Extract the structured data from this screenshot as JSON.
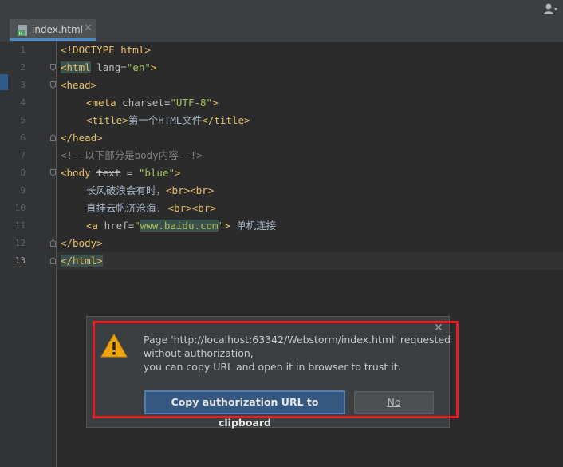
{
  "editor": {
    "tab": {
      "label": "index.html",
      "close": "✕"
    },
    "line_numbers": [
      "1",
      "2",
      "3",
      "4",
      "5",
      "6",
      "7",
      "8",
      "9",
      "10",
      "11",
      "12",
      "13"
    ],
    "lines": {
      "l1": {
        "tag": "<!DOCTYPE html>"
      },
      "l2": {
        "open": "<html",
        "attr": " lang=",
        "val": "\"en\"",
        "close": ">"
      },
      "l3": {
        "tag": "<head>"
      },
      "l4": {
        "open": "<meta",
        "attr": " charset=",
        "val": "\"UTF-8\"",
        "close": ">"
      },
      "l5": {
        "open": "<title>",
        "text": "第一个HTML文件",
        "close": "</title>"
      },
      "l6": {
        "tag": "</head>"
      },
      "l7": {
        "comment": "<!--以下部分是body内容--!>"
      },
      "l8": {
        "open": "<body",
        "attr": "text",
        "eq": " = ",
        "val": "\"blue\"",
        "close": ">"
      },
      "l9": {
        "text": "长风破浪会有时，",
        "tag": "<br><br>"
      },
      "l10": {
        "text": "直挂云帆济沧海. ",
        "tag": "<br><br>"
      },
      "l11": {
        "open": "<a",
        "attr": " href=",
        "q1": "\"",
        "url": "www.baidu.com",
        "q2": "\"",
        "close": ">",
        "text": " 单机连接"
      },
      "l12": {
        "tag": "</body>"
      },
      "l13": {
        "tag": "</html>"
      }
    }
  },
  "dialog": {
    "message_line1": "Page 'http://localhost:63342/Webstorm/index.html' requested",
    "message_line2": "without authorization,",
    "message_line3": "you can copy URL and open it in browser to trust it.",
    "copy_button": "Copy authorization URL to clipboard",
    "no_button": "No",
    "close": "✕"
  },
  "colors": {
    "highlight_box": "#e81e25",
    "primary_button": "#365880",
    "tag": "#e8bf6a",
    "string": "#a5c25c"
  },
  "icons": [
    "user-icon",
    "html-file-icon",
    "close-icon",
    "warning-icon",
    "fold-icon"
  ]
}
